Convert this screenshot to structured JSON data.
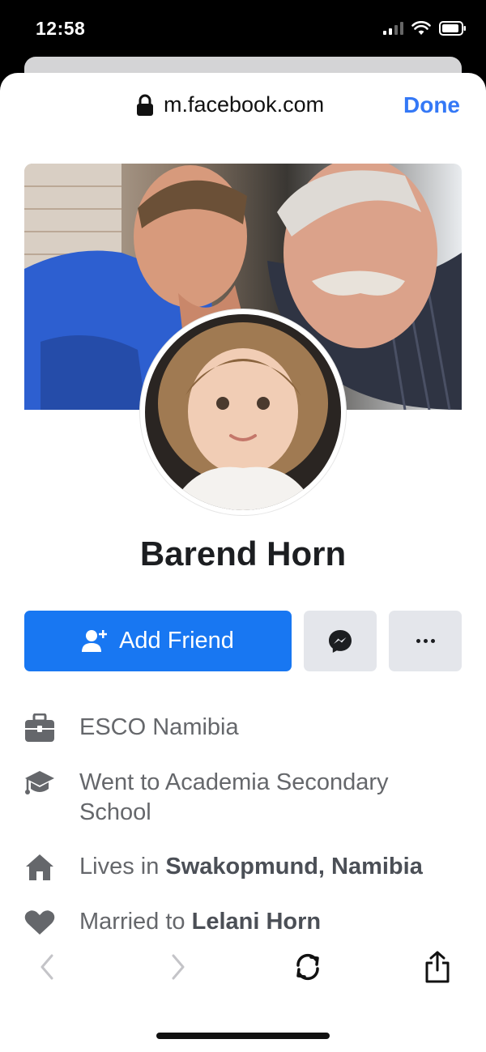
{
  "status_bar": {
    "time": "12:58",
    "icons": [
      "signal-icon",
      "wifi-icon",
      "battery-icon"
    ]
  },
  "browser": {
    "url": "m.facebook.com",
    "done_label": "Done",
    "accent_color": "#3478f6"
  },
  "profile": {
    "name": "Barend Horn",
    "add_friend_label": "Add Friend",
    "button_color": "#1877f2"
  },
  "details": [
    {
      "icon": "briefcase-icon",
      "prefix": "ESCO Namibia",
      "bold": ""
    },
    {
      "icon": "graduation-cap-icon",
      "prefix": "Went to Academia Secondary School",
      "bold": ""
    },
    {
      "icon": "house-icon",
      "prefix": "Lives in ",
      "bold": "Swakopmund, Namibia"
    },
    {
      "icon": "heart-icon",
      "prefix": "Married to ",
      "bold": "Lelani Horn"
    }
  ],
  "toolbar": {
    "icons": [
      "back-chevron-icon",
      "forward-chevron-icon",
      "reload-icon",
      "share-icon"
    ]
  }
}
